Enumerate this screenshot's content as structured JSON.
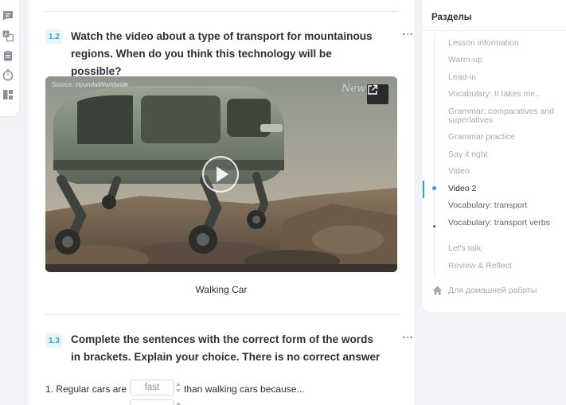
{
  "tool_rail": {
    "icons": [
      "chat-icon",
      "translate-icon",
      "notes-icon",
      "timer-icon",
      "layout-icon"
    ]
  },
  "task_1_2": {
    "number": "1.2",
    "title": "Watch the video about a type of transport for mountainous regions. When do you think this technology will be possible?",
    "video": {
      "source_label": "Source: HyundaiWorldwide",
      "watermark": "New",
      "caption": "Walking Car"
    }
  },
  "task_1_3": {
    "number": "1.3",
    "title": "Complete the sentences with the correct form of the words in brackets. Explain your choice. There is no correct answer",
    "sentence_1": {
      "prefix": "1. Regular cars are",
      "placeholder": "fast",
      "suffix": "than walking cars because..."
    }
  },
  "sections": {
    "title": "Разделы",
    "items": [
      {
        "label": "Lesson information"
      },
      {
        "label": "Warm-up"
      },
      {
        "label": "Lead-in"
      },
      {
        "label": "Vocabulary: It takes me..."
      },
      {
        "label": "Grammar: comparatives and superlatives"
      },
      {
        "label": "Grammar practice"
      },
      {
        "label": "Say it right"
      },
      {
        "label": "Video"
      },
      {
        "label": "Video 2"
      },
      {
        "label": "Vocabulary: transport"
      },
      {
        "label": "Vocabulary: transport verbs"
      },
      {
        "label": "Let's talk"
      },
      {
        "label": "Review & Reflect"
      }
    ],
    "active_index": 8,
    "homework_label": "Для домашней работы"
  },
  "colors": {
    "accent": "#2d9fe0",
    "badge_bg": "#eaf6fd",
    "text": "#2b2f36",
    "muted": "#a4aab2"
  }
}
